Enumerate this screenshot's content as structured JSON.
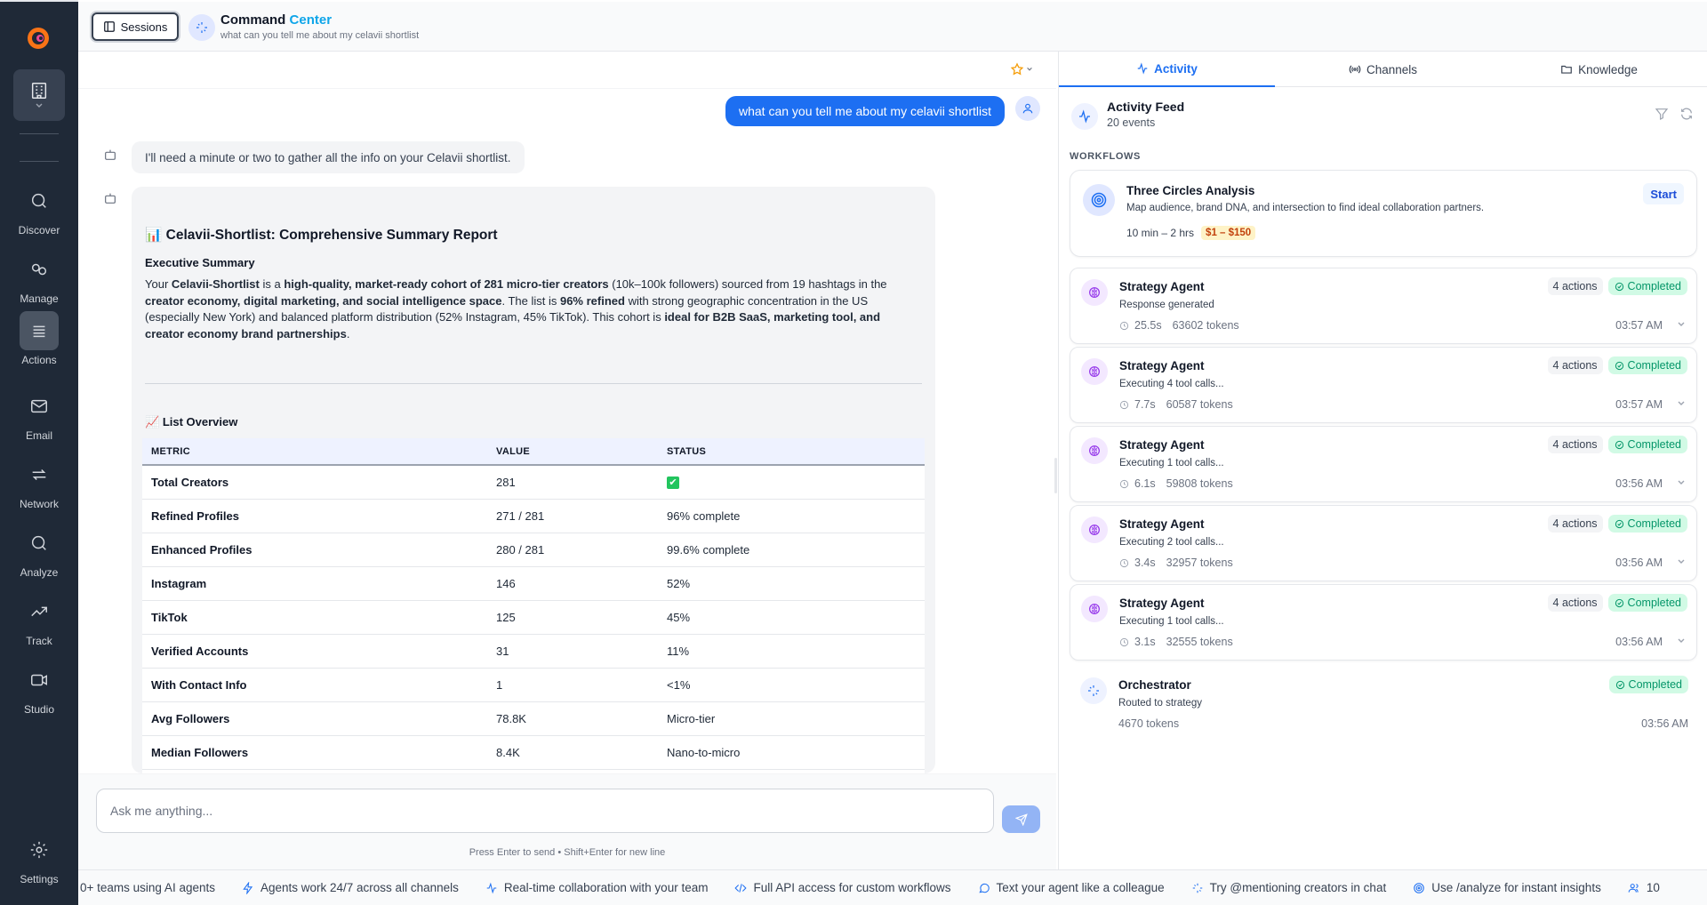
{
  "header": {
    "sessions_label": "Sessions",
    "title_main": "Command ",
    "title_accent": "Center",
    "subtitle": "what can you tell me about my celavii shortlist"
  },
  "nav": [
    {
      "label": "Discover",
      "icon": "search-icon"
    },
    {
      "label": "Manage",
      "icon": "link-icon"
    },
    {
      "label": "Actions",
      "icon": "list-icon"
    },
    {
      "label": "Email",
      "icon": "mail-icon"
    },
    {
      "label": "Network",
      "icon": "arrows-icon"
    },
    {
      "label": "Analyze",
      "icon": "search-icon"
    },
    {
      "label": "Track",
      "icon": "trend-icon"
    },
    {
      "label": "Studio",
      "icon": "video-icon"
    },
    {
      "label": "Settings",
      "icon": "gear-icon"
    }
  ],
  "chat": {
    "user_message": "what can you tell me about my celavii shortlist",
    "bot_message": "I'll need a minute or two to gather all the info on your Celavii shortlist.",
    "report": {
      "title_icon": "📊",
      "title": "Celavii-Shortlist: Comprehensive Summary Report",
      "exec_heading": "Executive Summary",
      "exec_parts": {
        "p1": "Your ",
        "b1": "Celavii-Shortlist",
        "p2": " is a ",
        "b2": "high-quality, market-ready cohort of 281 micro-tier creators",
        "p3": " (10k–100k followers) sourced from 19 hashtags in the ",
        "b3": "creator economy, digital marketing, and social intelligence space",
        "p4": ". The list is ",
        "b4": "96% refined",
        "p5": " with strong geographic concentration in the US (especially New York) and balanced platform distribution (52% Instagram, 45% TikTok). This cohort is ",
        "b5": "ideal for B2B SaaS, marketing tool, and creator economy brand partnerships",
        "p6": "."
      },
      "overview_icon": "📈",
      "overview_heading": "List Overview",
      "columns": [
        "METRIC",
        "VALUE",
        "STATUS"
      ],
      "rows": [
        {
          "metric": "Total Creators",
          "value": "281",
          "status": "✔"
        },
        {
          "metric": "Refined Profiles",
          "value": "271 / 281",
          "status": "96% complete"
        },
        {
          "metric": "Enhanced Profiles",
          "value": "280 / 281",
          "status": "99.6% complete"
        },
        {
          "metric": "Instagram",
          "value": "146",
          "status": "52%"
        },
        {
          "metric": "TikTok",
          "value": "125",
          "status": "45%"
        },
        {
          "metric": "Verified Accounts",
          "value": "31",
          "status": "11%"
        },
        {
          "metric": "With Contact Info",
          "value": "1",
          "status": "<1%"
        },
        {
          "metric": "Avg Followers",
          "value": "78.8K",
          "status": "Micro-tier"
        },
        {
          "metric": "Median Followers",
          "value": "8.4K",
          "status": "Nano-to-micro"
        }
      ]
    },
    "input_placeholder": "Ask me anything...",
    "hint": "Press Enter to send • Shift+Enter for new line"
  },
  "panel": {
    "tabs": [
      {
        "label": "Activity",
        "icon": "activity-icon"
      },
      {
        "label": "Channels",
        "icon": "broadcast-icon"
      },
      {
        "label": "Knowledge",
        "icon": "folder-icon"
      }
    ],
    "feed_title": "Activity Feed",
    "feed_count": "20 events",
    "workflows_label": "WORKFLOWS",
    "workflow": {
      "title": "Three Circles Analysis",
      "desc": "Map audience, brand DNA, and intersection to find ideal collaboration partners.",
      "duration": "10 min – 2 hrs",
      "cost": "$1 – $150",
      "start": "Start"
    },
    "events": [
      {
        "title": "Strategy Agent",
        "desc": "Response generated",
        "duration": "25.5s",
        "tokens": "63602 tokens",
        "time": "03:57 AM",
        "actions": "4 actions",
        "status": "Completed"
      },
      {
        "title": "Strategy Agent",
        "desc": "Executing 4 tool calls...",
        "duration": "7.7s",
        "tokens": "60587 tokens",
        "time": "03:57 AM",
        "actions": "4 actions",
        "status": "Completed"
      },
      {
        "title": "Strategy Agent",
        "desc": "Executing 1 tool calls...",
        "duration": "6.1s",
        "tokens": "59808 tokens",
        "time": "03:56 AM",
        "actions": "4 actions",
        "status": "Completed"
      },
      {
        "title": "Strategy Agent",
        "desc": "Executing 2 tool calls...",
        "duration": "3.4s",
        "tokens": "32957 tokens",
        "time": "03:56 AM",
        "actions": "4 actions",
        "status": "Completed"
      },
      {
        "title": "Strategy Agent",
        "desc": "Executing 1 tool calls...",
        "duration": "3.1s",
        "tokens": "32555 tokens",
        "time": "03:56 AM",
        "actions": "4 actions",
        "status": "Completed"
      }
    ],
    "orchestrator": {
      "title": "Orchestrator",
      "desc": "Routed to strategy",
      "tokens": "4670 tokens",
      "time": "03:56 AM",
      "status": "Completed"
    }
  },
  "ticker": [
    {
      "text": "0+ teams using AI agents",
      "icon": ""
    },
    {
      "text": "Agents work 24/7 across all channels",
      "icon": "bolt-icon"
    },
    {
      "text": "Real-time collaboration with your team",
      "icon": "activity-icon"
    },
    {
      "text": "Full API access for custom workflows",
      "icon": "code-icon"
    },
    {
      "text": "Text your agent like a colleague",
      "icon": "chat-icon"
    },
    {
      "text": "Try @mentioning creators in chat",
      "icon": "sparkle-icon"
    },
    {
      "text": "Use /analyze for instant insights",
      "icon": "target-icon"
    },
    {
      "text": "10",
      "icon": "users-icon"
    }
  ],
  "colors": {
    "accent": "#1d6ff2",
    "rail": "#1f2937",
    "completed": "#059669"
  }
}
